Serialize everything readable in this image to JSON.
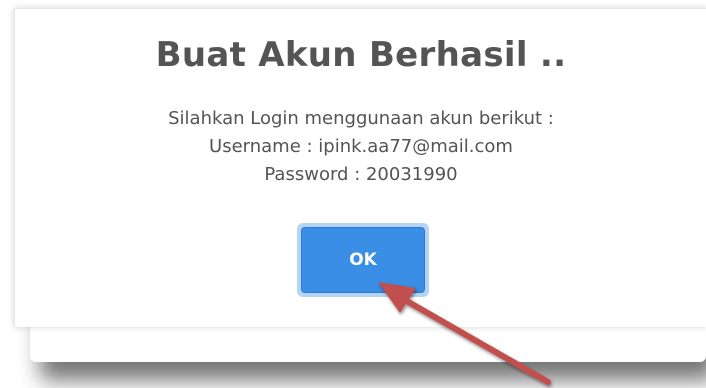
{
  "dialog": {
    "title": "Buat Akun Berhasil ..",
    "message_lines": [
      "Silahkan Login menggunaan akun berikut :",
      "Username : ipink.aa77@mail.com",
      "Password : 20031990"
    ],
    "ok_label": "OK"
  },
  "colors": {
    "title_text": "#545454",
    "button_bg": "#3a8ee6",
    "button_focus_ring": "#b7d3f2",
    "annotation_arrow": "#c0504d"
  },
  "icons": {
    "annotation": "arrow-pointer-icon"
  }
}
